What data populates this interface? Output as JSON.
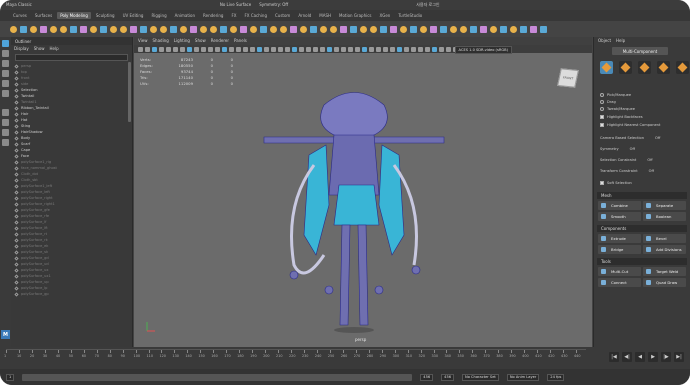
{
  "statusline": {
    "workspace": "Maya Classic",
    "live_surface": "No Live Surface",
    "symmetry": "Symmetry: Off",
    "user": "사용자 로그인"
  },
  "shelf_tabs": [
    "Curves",
    "Surfaces",
    "Poly Modeling",
    "Sculpting",
    "UV Editing",
    "Rigging",
    "Animation",
    "Rendering",
    "FX",
    "FX Caching",
    "Custom",
    "Arnold",
    "MASH",
    "Motion Graphics",
    "XGen",
    "TurtleStudio"
  ],
  "active_shelf_tab": "Poly Modeling",
  "outliner": {
    "title": "Outliner",
    "menu": [
      "Display",
      "Show",
      "Help"
    ],
    "search_placeholder": "Search...",
    "items": [
      {
        "label": "persp",
        "dim": true
      },
      {
        "label": "top",
        "dim": true
      },
      {
        "label": "front",
        "dim": true
      },
      {
        "label": "side",
        "dim": true
      },
      {
        "label": "Selection",
        "dim": false
      },
      {
        "label": "Twintail",
        "dim": false
      },
      {
        "label": "Twintail1",
        "dim": true
      },
      {
        "label": "Ribbon_Twintail",
        "dim": false
      },
      {
        "label": "Hair",
        "dim": false
      },
      {
        "label": "Hat",
        "dim": false
      },
      {
        "label": "Sting",
        "dim": false
      },
      {
        "label": "HairShadow",
        "dim": false
      },
      {
        "label": "Body",
        "dim": false
      },
      {
        "label": "Scarf",
        "dim": false
      },
      {
        "label": "Cape",
        "dim": false
      },
      {
        "label": "Face",
        "dim": false
      },
      {
        "label": "polySurface1_rig",
        "dim": true
      },
      {
        "label": "face_nommal_ghost",
        "dim": true
      },
      {
        "label": "Cloth_dot",
        "dim": true
      },
      {
        "label": "Cloth_sbt",
        "dim": true
      },
      {
        "label": "polySurface1_left",
        "dim": true
      },
      {
        "label": "polySurface_left",
        "dim": true
      },
      {
        "label": "polySurface_right",
        "dim": true
      },
      {
        "label": "polySurface_right1",
        "dim": true
      },
      {
        "label": "polySurface_gfe",
        "dim": true
      },
      {
        "label": "polySurface_rfe",
        "dim": true
      },
      {
        "label": "polySurface_lf",
        "dim": true
      },
      {
        "label": "polySurface_lft",
        "dim": true
      },
      {
        "label": "polySurface_rt",
        "dim": true
      },
      {
        "label": "polySurface_rk",
        "dim": true
      },
      {
        "label": "polySurface_ek",
        "dim": true
      },
      {
        "label": "polySurface_sk",
        "dim": true
      },
      {
        "label": "polySurface_gd",
        "dim": true
      },
      {
        "label": "polySurface_ud",
        "dim": true
      },
      {
        "label": "polySurface_ux",
        "dim": true
      },
      {
        "label": "polySurface_ux1",
        "dim": true
      },
      {
        "label": "polySurface_up",
        "dim": true
      },
      {
        "label": "polySurface_lp",
        "dim": true
      },
      {
        "label": "polySurface_gp",
        "dim": true
      }
    ]
  },
  "viewport": {
    "menu": [
      "View",
      "Shading",
      "Lighting",
      "Show",
      "Renderer",
      "Panels"
    ],
    "hud": [
      {
        "k": "Verts:",
        "v": "87243",
        "a": "0",
        "b": "0"
      },
      {
        "k": "Edges:",
        "v": "180550",
        "a": "0",
        "b": "0"
      },
      {
        "k": "Faces:",
        "v": "93744",
        "a": "0",
        "b": "0"
      },
      {
        "k": "Tris:",
        "v": "171140",
        "a": "0",
        "b": "0"
      },
      {
        "k": "UVs:",
        "v": "112009",
        "a": "0",
        "b": "0"
      }
    ],
    "color_mgmt": "ACES 1.0 SDR-video (sRGB)",
    "camera": "persp",
    "viewcube_label": "FRONT"
  },
  "right_panel": {
    "menu": [
      "Object",
      "Help"
    ],
    "tab": "Multi-Component",
    "options": [
      {
        "label": "Pick/Marquee",
        "type": "radio"
      },
      {
        "label": "Drag",
        "type": "radio"
      },
      {
        "label": "Tweak/Marquee",
        "type": "radio"
      },
      {
        "label": "Highlight Backfaces",
        "type": "check"
      },
      {
        "label": "Highlight Nearest Component",
        "type": "check"
      }
    ],
    "settings": [
      {
        "label": "Camera Based Selection",
        "value": "Off"
      },
      {
        "label": "Symmetry",
        "value": "Off"
      },
      {
        "label": "Selection Constraint",
        "value": "Off"
      },
      {
        "label": "Transform Constraint",
        "value": "Off"
      }
    ],
    "soft_selection": "Soft Selection",
    "sections": {
      "mesh": {
        "title": "Mesh",
        "buttons": [
          "Combine",
          "Separate",
          "Smooth",
          "Boolean"
        ]
      },
      "components": {
        "title": "Components",
        "buttons": [
          "Extrude",
          "Bevel",
          "Bridge",
          "Add Divisions"
        ]
      },
      "tools": {
        "title": "Tools",
        "buttons": [
          "Multi-Cut",
          "Target Weld",
          "Connect",
          "Quad Draw"
        ]
      }
    }
  },
  "timeline": {
    "labels": [
      "1",
      "10",
      "20",
      "30",
      "40",
      "50",
      "60",
      "70",
      "80",
      "90",
      "100",
      "110",
      "120",
      "130",
      "140",
      "150",
      "160",
      "170",
      "180",
      "190",
      "200",
      "210",
      "220",
      "230",
      "240",
      "250",
      "260",
      "270",
      "280",
      "290",
      "300",
      "310",
      "320",
      "330",
      "340",
      "350",
      "360",
      "370",
      "380",
      "390",
      "400",
      "410",
      "420",
      "430",
      "440"
    ],
    "current": "1"
  },
  "range": {
    "start": "1",
    "end": "456",
    "anim_end": "456",
    "char_set": "No Character Set",
    "anim_layer": "No Anim Layer",
    "fps": "24 fps"
  },
  "colors": {
    "accent": "#4fa3d9",
    "wire": "#2a2a8a",
    "cyan": "#39b5d6"
  }
}
